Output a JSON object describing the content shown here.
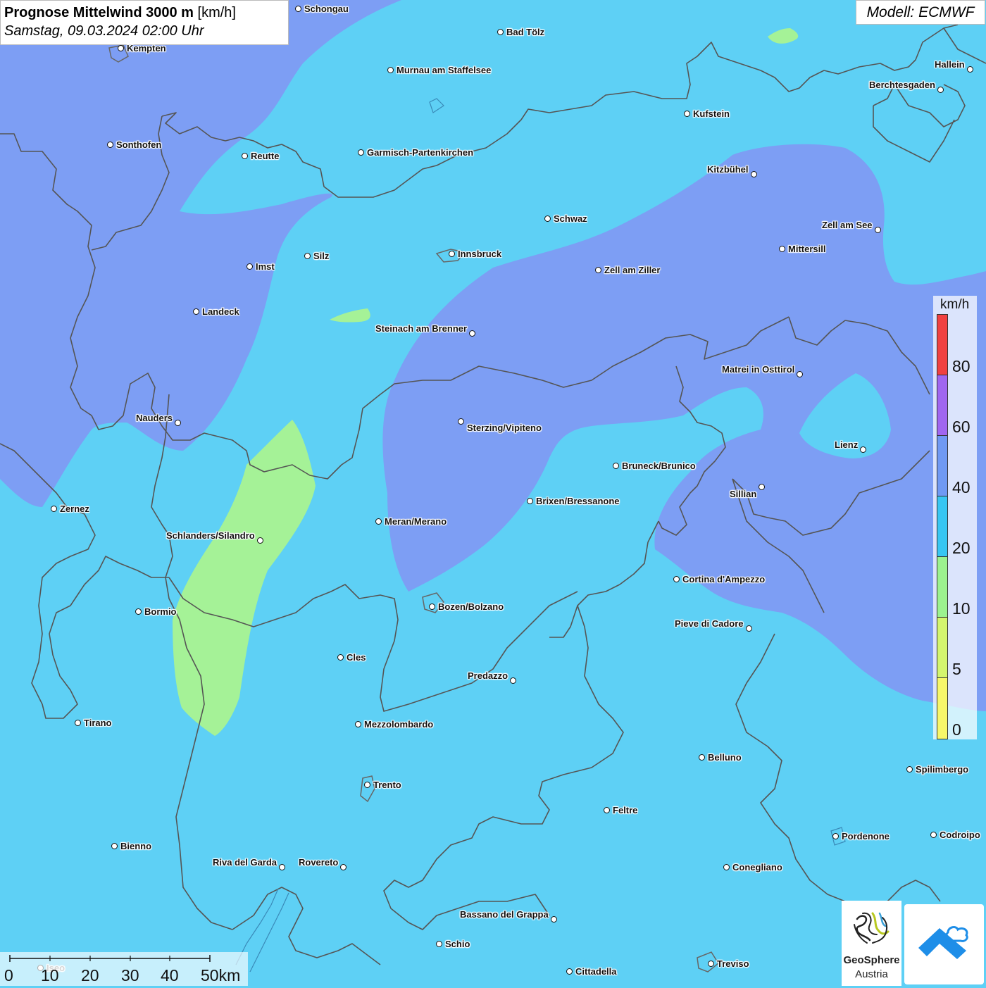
{
  "header": {
    "title_bold": "Prognose Mittelwind 3000 m",
    "title_unit": "[km/h]",
    "datetime": "Samstag, 09.03.2024 02:00 Uhr",
    "model": "Modell: ECMWF"
  },
  "legend": {
    "unit": "km/h",
    "ticks": [
      "80",
      "60",
      "40",
      "20",
      "10",
      "5",
      "0"
    ],
    "bands": [
      {
        "range": "0-5",
        "color": "#f7f76a"
      },
      {
        "range": "5-10",
        "color": "#d4f56e"
      },
      {
        "range": "10-20",
        "color": "#9cf28f"
      },
      {
        "range": "20-40",
        "color": "#38c6f2"
      },
      {
        "range": "40-60",
        "color": "#6f99f3"
      },
      {
        "range": "60-80",
        "color": "#a066f0"
      },
      {
        "range": "80+",
        "color": "#f04040"
      }
    ]
  },
  "field_colors": {
    "light_blue_10_20": "#5ed0f5",
    "blue_20_40": "#7d9ef4",
    "green_5_10": "#a5f297"
  },
  "scalebar": {
    "labels": [
      "0",
      "10",
      "20",
      "30",
      "40",
      "50km"
    ]
  },
  "logos": {
    "geosphere_line1": "GeoSphere",
    "geosphere_line2": "Austria"
  },
  "cities": [
    "Schongau",
    "Bad Tölz",
    "Kempten",
    "Murnau am Staffelsee",
    "Hallein",
    "Berchtesgaden",
    "Kufstein",
    "Sonthofen",
    "Reutte",
    "Garmisch-Partenkirchen",
    "Kitzbühel",
    "Schwaz",
    "Zell am See",
    "Mittersill",
    "Innsbruck",
    "Imst",
    "Silz",
    "Zell am Ziller",
    "Landeck",
    "Steinach am Brenner",
    "Matrei in Osttirol",
    "Nauders",
    "Sterzing/Vipiteno",
    "Lienz",
    "Bruneck/Brunico",
    "Sillian",
    "Zernez",
    "Brixen/Bressanone",
    "Meran/Merano",
    "Schlanders/Silandro",
    "Cortina d'Ampezzo",
    "Bozen/Bolzano",
    "Bormio",
    "Pieve di Cadore",
    "Cles",
    "Predazzo",
    "Tirano",
    "Mezzolombardo",
    "Belluno",
    "Spilimbergo",
    "Trento",
    "Feltre",
    "Pordenone",
    "Codroipo",
    "Bienno",
    "Riva del Garda",
    "Rovereto",
    "Conegliano",
    "Bassano del Grappa",
    "Schio",
    "Treviso",
    "Cittadella",
    "Iseo"
  ]
}
